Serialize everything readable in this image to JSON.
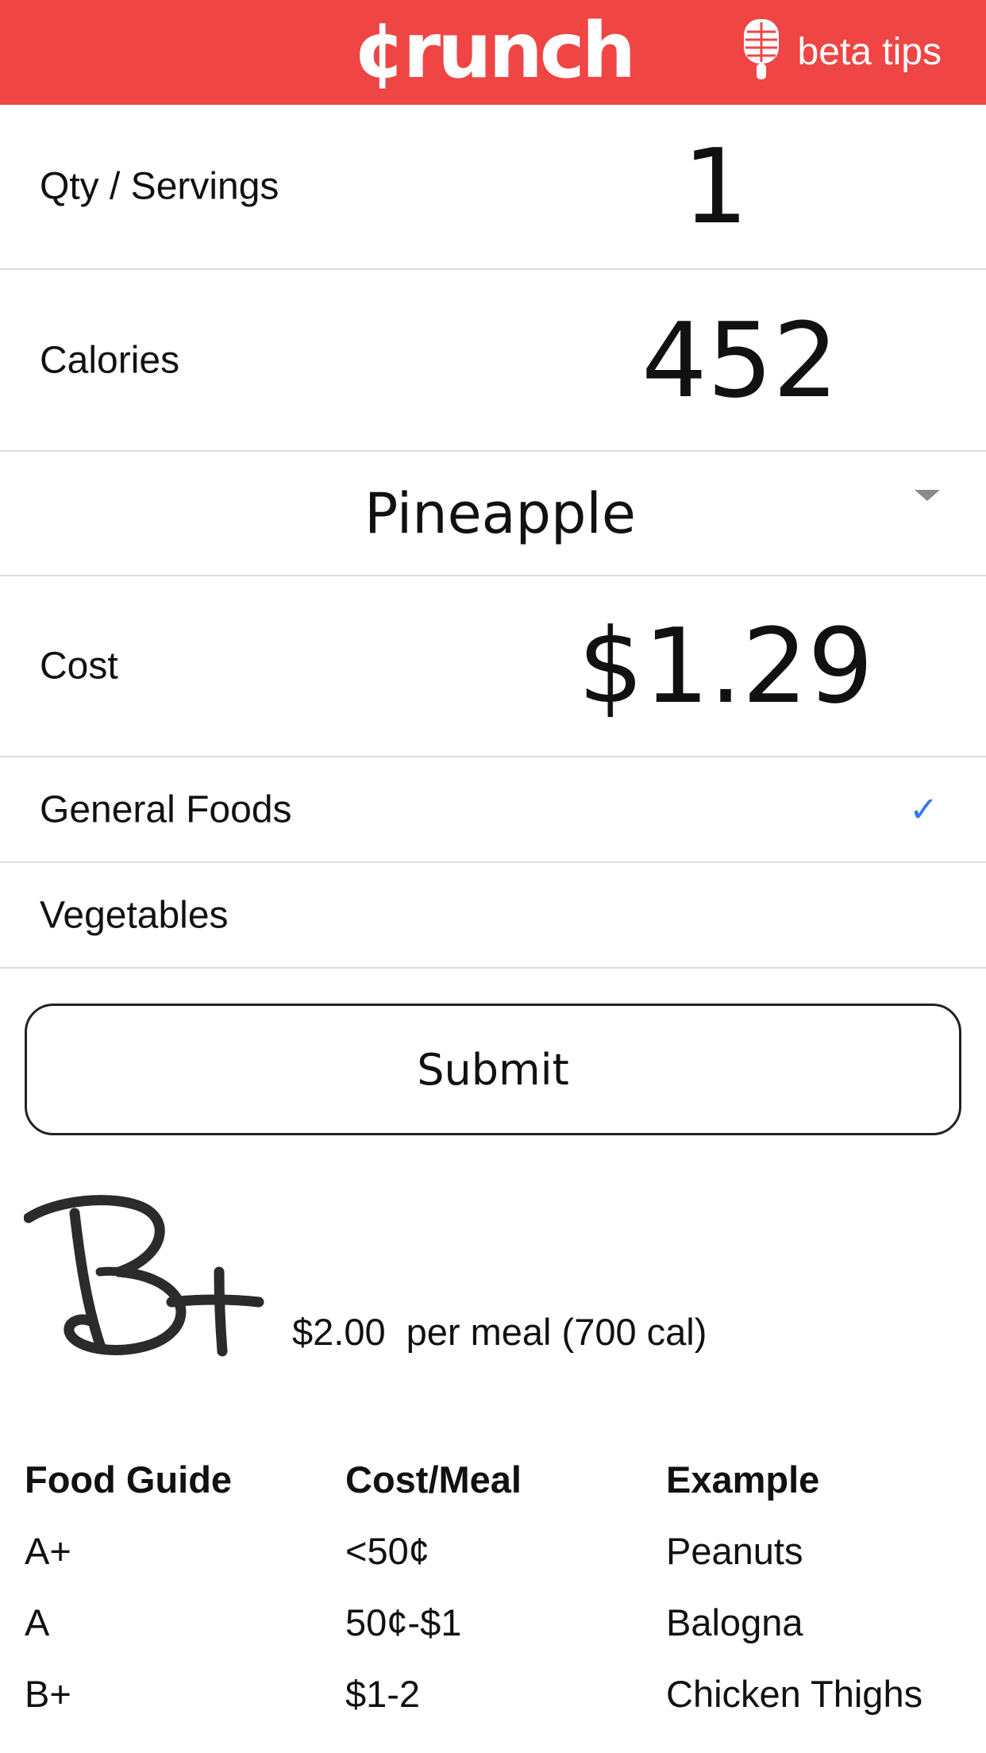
{
  "header": {
    "logo_text": "¢runch",
    "beta_label": "beta tips",
    "brand_color": "#f04545",
    "beta_icon": "microphone-icon"
  },
  "form": {
    "qty": {
      "label": "Qty / Servings",
      "value": "1"
    },
    "calories": {
      "label": "Calories",
      "value": "452"
    },
    "food": {
      "selected": "Pineapple",
      "icon": "dropdown-caret-icon"
    },
    "cost": {
      "label": "Cost",
      "value": "$1.29"
    },
    "categories": [
      {
        "label": "General Foods",
        "checked": true
      },
      {
        "label": "Vegetables",
        "checked": false
      }
    ],
    "check_color": "#3478f6",
    "check_glyph": "✓"
  },
  "submit": {
    "label": "Submit"
  },
  "grade": {
    "letter": "B+",
    "price": "$2.00",
    "description": "per meal (700 cal)"
  },
  "guide": {
    "headers": [
      "Food Guide",
      "Cost/Meal",
      "Example"
    ],
    "rows": [
      [
        "A+",
        "<50¢",
        "Peanuts"
      ],
      [
        "A",
        "50¢-$1",
        "Balogna"
      ],
      [
        "B+",
        "$1-2",
        "Chicken Thighs"
      ]
    ]
  }
}
